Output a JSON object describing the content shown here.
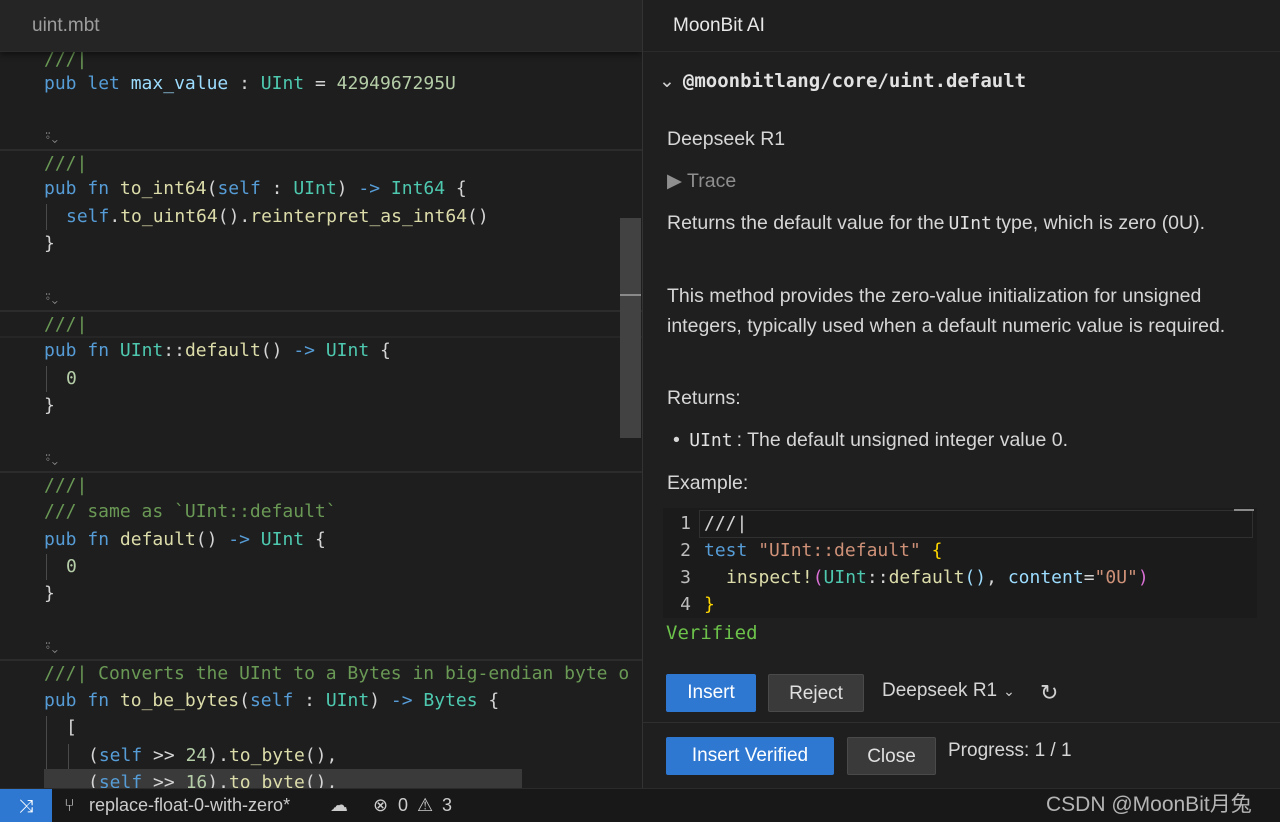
{
  "editor": {
    "tab_title": "uint.mbt",
    "lens_icon": "⍤⌄"
  },
  "ai_panel": {
    "title": "MoonBit AI",
    "source_chevron": "⌄",
    "source": "@moonbitlang/core/uint.default",
    "model_label": "Deepseek R1",
    "trace_label": "▶ Trace",
    "desc1_pre": "Returns the default value for the",
    "desc1_code": "UInt",
    "desc1_post": "type, which is zero (0U).",
    "desc2": "This method provides the zero-value initialization for unsigned integers, typically used when a default numeric value is required.",
    "returns_heading": "Returns:",
    "returns_bullet": "•",
    "returns_code": "UInt",
    "returns_text": ": The default unsigned integer value 0.",
    "example_heading": "Example:",
    "line_numbers": [
      "1",
      "2",
      "3",
      "4"
    ],
    "verified": "Verified",
    "insert_label": "Insert",
    "reject_label": "Reject",
    "model_select": "Deepseek R1",
    "model_chevron": "⌄",
    "refresh_icon": "↻",
    "insert_verified_label": "Insert Verified",
    "close_label": "Close",
    "progress": "Progress: 1 / 1"
  },
  "statusbar": {
    "remote_icon": "⤨",
    "branch_icon": "⑂",
    "branch": "replace-float-0-with-zero*",
    "sync_icon": "☁",
    "errors_icon": "⊗",
    "errors": "0",
    "warnings_icon": "⚠",
    "warnings": "3"
  },
  "watermark": "CSDN @MoonBit月兔"
}
